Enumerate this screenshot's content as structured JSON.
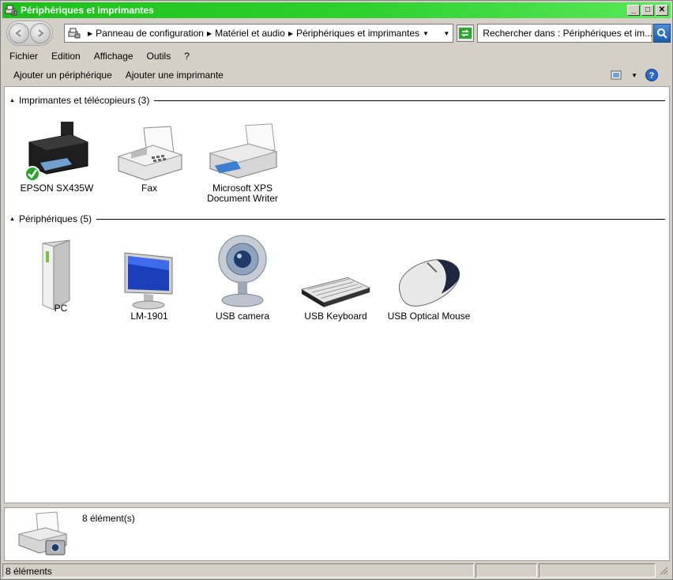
{
  "window": {
    "title": "Périphériques et imprimantes",
    "accent": "#22c322"
  },
  "address": {
    "crumbs": [
      "Panneau de configuration",
      "Matériel et audio",
      "Périphériques et imprimantes"
    ],
    "search_placeholder": "Rechercher dans : Périphériques et im..."
  },
  "menu": [
    "Fichier",
    "Edition",
    "Affichage",
    "Outils",
    "?"
  ],
  "commands": [
    "Ajouter un périphérique",
    "Ajouter une imprimante"
  ],
  "groups": {
    "printers": {
      "label": "Imprimantes et télécopieurs (3)",
      "items": [
        {
          "label": "EPSON SX435W",
          "icon": "printer-default-icon"
        },
        {
          "label": "Fax",
          "icon": "fax-icon"
        },
        {
          "label": "Microsoft XPS Document Writer",
          "icon": "xps-printer-icon"
        }
      ]
    },
    "devices": {
      "label": "Périphériques (5)",
      "items": [
        {
          "label": "PC",
          "icon": "pc-tower-icon"
        },
        {
          "label": "LM-1901",
          "icon": "monitor-icon"
        },
        {
          "label": "USB camera",
          "icon": "webcam-icon"
        },
        {
          "label": "USB Keyboard",
          "icon": "keyboard-icon"
        },
        {
          "label": "USB Optical Mouse",
          "icon": "mouse-icon"
        }
      ]
    }
  },
  "details": {
    "count": "8 élément(s)"
  },
  "statusbar": {
    "text": "8 éléments"
  }
}
